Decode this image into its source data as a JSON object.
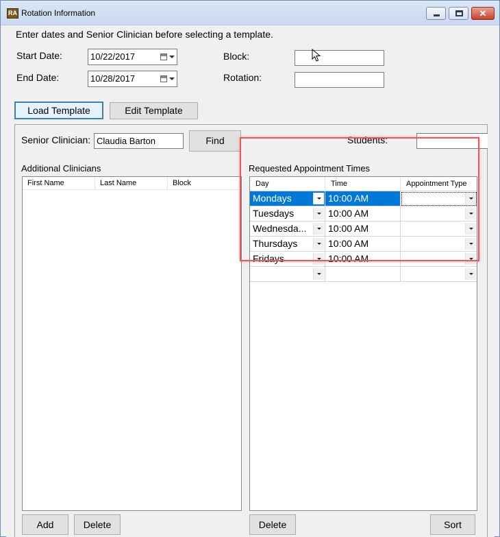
{
  "window": {
    "icon_text": "RA",
    "title": "Rotation Information",
    "controls": {
      "close": "✕"
    }
  },
  "form": {
    "instruction": "Enter dates and Senior Clinician before selecting a template.",
    "start_date_label": "Start Date:",
    "start_date_value": "10/22/2017",
    "end_date_label": "End Date:",
    "end_date_value": "10/28/2017",
    "block_label": "Block:",
    "block_value": "",
    "rotation_label": "Rotation:",
    "rotation_value": "",
    "load_template_button": "Load Template",
    "edit_template_button": "Edit Template"
  },
  "clinicians": {
    "senior_label": "Senior Clinician:",
    "senior_value": "Claudia Barton",
    "find_button": "Find",
    "students_label": "Students:",
    "students_value": "",
    "additional_title": "Additional Clinicians",
    "columns": [
      "First Name",
      "Last Name",
      "Block"
    ],
    "add_button": "Add",
    "delete_button": "Delete"
  },
  "appointments": {
    "title": "Requested Appointment Times",
    "columns": [
      "Day",
      "Time",
      "Appointment Type"
    ],
    "rows": [
      {
        "day": "Mondays",
        "time": "10:00 AM",
        "type": ""
      },
      {
        "day": "Tuesdays",
        "time": "10:00 AM",
        "type": ""
      },
      {
        "day": "Wednesda...",
        "time": "10:00 AM",
        "type": ""
      },
      {
        "day": "Thursdays",
        "time": "10:00 AM",
        "type": ""
      },
      {
        "day": "Fridays",
        "time": "10:00 AM",
        "type": ""
      },
      {
        "day": "",
        "time": "",
        "type": ""
      }
    ],
    "delete_button": "Delete",
    "sort_button": "Sort"
  },
  "colors": {
    "selection": "#0078d7",
    "highlight_border": "#e45a5a",
    "default_button_border": "#3c7fb1"
  }
}
